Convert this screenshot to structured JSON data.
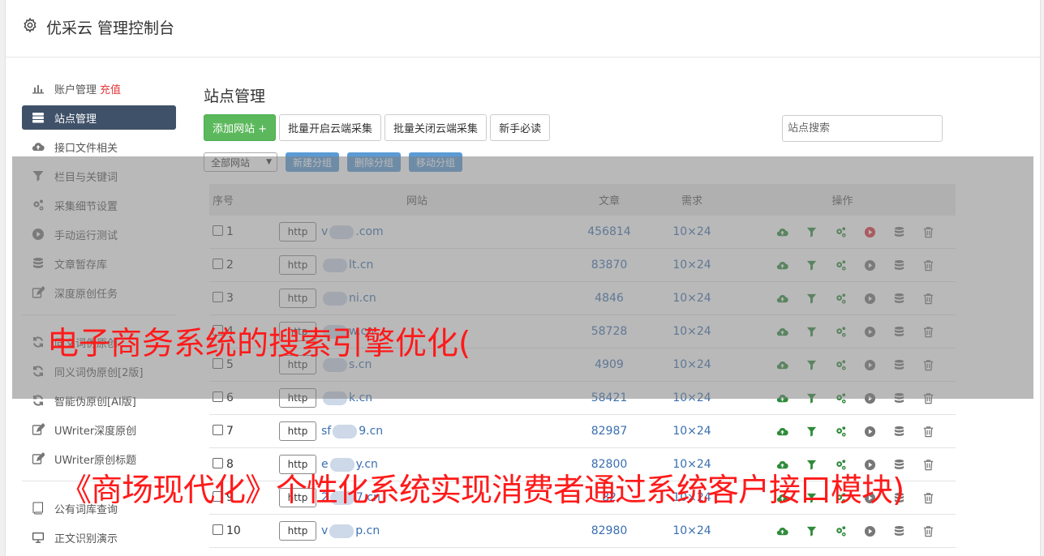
{
  "header": {
    "title": "优采云 管理控制台"
  },
  "sidebar": {
    "items": [
      {
        "label": "账户管理",
        "extra": "充值",
        "icon": "bar-chart-icon"
      },
      {
        "label": "站点管理",
        "icon": "server-icon",
        "active": true
      },
      {
        "label": "接口文件相关",
        "icon": "cloud-upload-icon"
      },
      {
        "label": "栏目与关键词",
        "icon": "filter-icon"
      },
      {
        "label": "采集细节设置",
        "icon": "gears-icon"
      },
      {
        "label": "手动运行测试",
        "icon": "play-circle-icon"
      },
      {
        "label": "文章暂存库",
        "icon": "database-icon"
      },
      {
        "label": "深度原创任务",
        "icon": "edit-icon"
      }
    ],
    "items2": [
      {
        "label": "同义词伪原创",
        "icon": "refresh-icon"
      },
      {
        "label": "同义词伪原创[2版]",
        "icon": "refresh-icon"
      },
      {
        "label": "智能伪原创[AI版]",
        "icon": "refresh-icon"
      },
      {
        "label": "UWriter深度原创",
        "icon": "edit-icon"
      },
      {
        "label": "UWriter原创标题",
        "icon": "edit-icon"
      }
    ],
    "items3": [
      {
        "label": "公有词库查询",
        "icon": "book-icon"
      },
      {
        "label": "正文识别演示",
        "icon": "monitor-icon"
      }
    ]
  },
  "main": {
    "title": "站点管理",
    "buttons": {
      "add": "添加网站 +",
      "batch_on": "批量开启云端采集",
      "batch_off": "批量关闭云端采集",
      "guide": "新手必读"
    },
    "search_placeholder": "站点搜索",
    "group_select": "全部网站",
    "group_buttons": {
      "new": "新建分组",
      "delete": "删除分组",
      "move": "移动分组"
    },
    "table": {
      "headers": {
        "num": "序号",
        "site": "网站",
        "articles": "文章",
        "demand": "需求",
        "ops": "操作"
      },
      "http_label": "http",
      "rows": [
        {
          "num": "1",
          "pre": "v",
          "suf": ".com",
          "articles": "456814",
          "demand": "10×24",
          "run_active": true
        },
        {
          "num": "2",
          "pre": "",
          "suf": "lt.cn",
          "articles": "83870",
          "demand": "10×24"
        },
        {
          "num": "3",
          "pre": "",
          "suf": "ni.cn",
          "articles": "4846",
          "demand": "10×24"
        },
        {
          "num": "4",
          "pre": "",
          "suf": "w.cn",
          "articles": "58728",
          "demand": "10×24"
        },
        {
          "num": "5",
          "pre": "",
          "suf": "s.cn",
          "articles": "4909",
          "demand": "10×24"
        },
        {
          "num": "6",
          "pre": "",
          "suf": "k.cn",
          "articles": "58421",
          "demand": "10×24"
        },
        {
          "num": "7",
          "pre": "sf",
          "suf": "9.cn",
          "articles": "82987",
          "demand": "10×24"
        },
        {
          "num": "8",
          "pre": "e",
          "suf": "y.cn",
          "articles": "82800",
          "demand": "10×24"
        },
        {
          "num": "9",
          "pre": "2",
          "suf": "7.cn",
          "articles": "82",
          "demand": "10×24"
        },
        {
          "num": "10",
          "pre": "v",
          "suf": "p.cn",
          "articles": "82980",
          "demand": "10×24"
        }
      ]
    }
  },
  "overlay": {
    "caption1": "电子商务系统的搜索引擎优化(",
    "caption2": "《商场现代化》个性化系统实现消费者通过系统客户接口模块)"
  },
  "colors": {
    "sidebar_active": "#3f5168",
    "green": "#5cb85c",
    "blue_btn": "#5b9bd5",
    "link": "#3a6fb0",
    "caption": "#ff1a1a"
  }
}
